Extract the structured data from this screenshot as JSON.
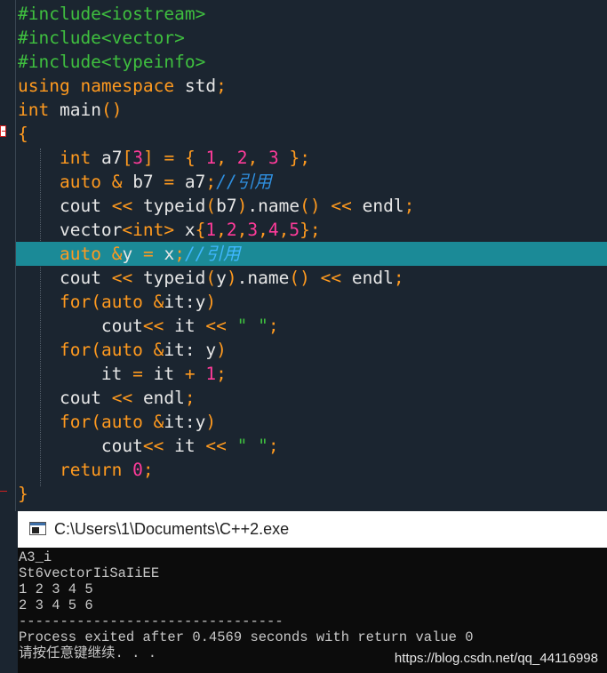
{
  "editor": {
    "lines": [
      "#include<iostream>",
      "#include<vector>",
      "#include<typeinfo>",
      "using namespace std;",
      "int main()",
      "{",
      "    int a7[3] = { 1, 2, 3 };",
      "    auto & b7 = a7;//引用",
      "    cout << typeid(b7).name() << endl;",
      "    vector<int> x{1,2,3,4,5};",
      "    auto &y = x;//引用",
      "    cout << typeid(y).name() << endl;",
      "    for(auto &it:y)",
      "        cout<< it << \" \";",
      "    for(auto &it: y)",
      "        it = it + 1;",
      "    cout << endl;",
      "    for(auto &it:y)",
      "        cout<< it << \" \";",
      "    return 0;",
      "}"
    ],
    "highlighted_line": 11,
    "colors": {
      "background": "#1b2530",
      "preprocessor": "#3fbf3f",
      "keyword": "#ff9a1f",
      "number": "#ff3b9a",
      "comment": "#2f8fdf",
      "highlight": "#1b8a97"
    }
  },
  "console": {
    "title": "C:\\Users\\1\\Documents\\C++2.exe",
    "lines": [
      "A3_i",
      "St6vectorIiSaIiEE",
      "1 2 3 4 5",
      "2 3 4 5 6",
      "--------------------------------",
      "Process exited after 0.4569 seconds with return value 0",
      "请按任意键继续. . ."
    ],
    "icon": "console-app-icon"
  },
  "watermark": "https://blog.csdn.net/qq_44116998"
}
